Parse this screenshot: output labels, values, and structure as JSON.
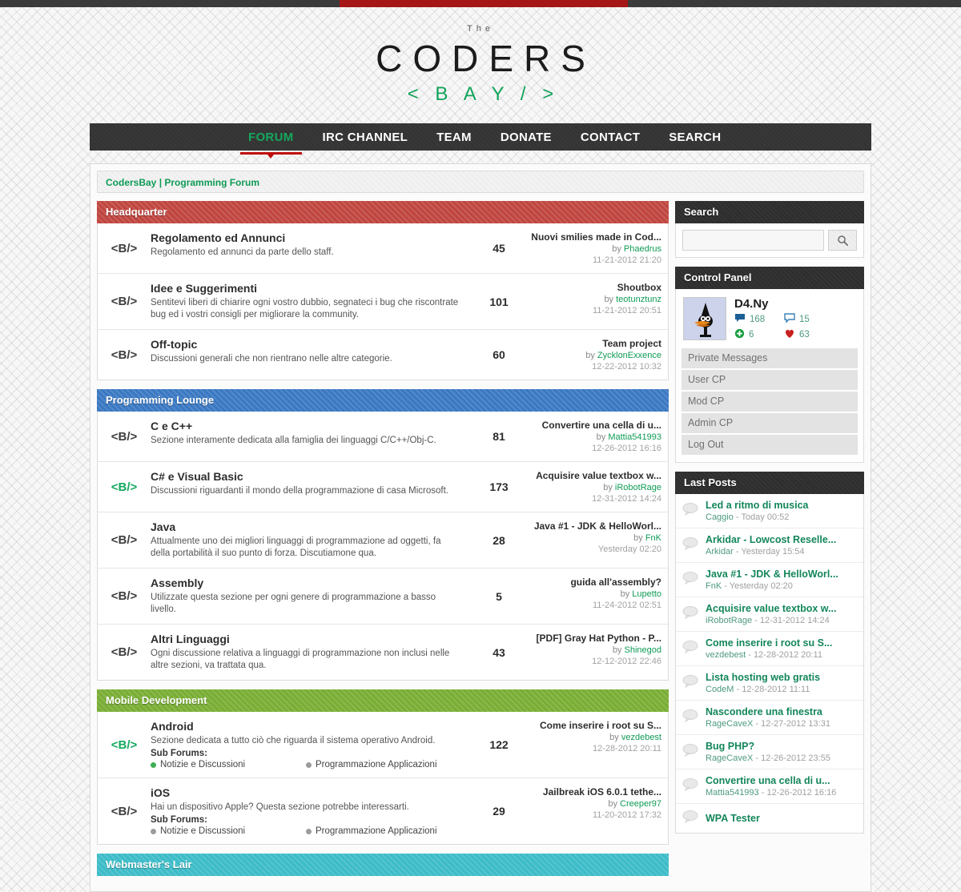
{
  "topbar": {
    "accent_color": "#a51616",
    "bar_color": "#3b3b3b"
  },
  "logo": {
    "pre": "The",
    "main": "CODERS",
    "sub": "< B A Y / >"
  },
  "nav": {
    "items": [
      {
        "label": "FORUM",
        "active": true
      },
      {
        "label": "IRC CHANNEL",
        "active": false
      },
      {
        "label": "TEAM",
        "active": false
      },
      {
        "label": "DONATE",
        "active": false
      },
      {
        "label": "CONTACT",
        "active": false
      },
      {
        "label": "SEARCH",
        "active": false
      }
    ],
    "active_color": "#14a85e",
    "underline_color": "#c00d0d"
  },
  "breadcrumb": {
    "text": "CodersBay | Programming Forum"
  },
  "categories": [
    {
      "title": "Headquarter",
      "color": "#c0453f",
      "forums": [
        {
          "icon": "code-tag-icon",
          "unread": false,
          "title": "Regolamento ed Annunci",
          "desc": "Regolamento ed annunci da parte dello staff.",
          "count": "45",
          "last_title": "Nuovi smilies made in Cod...",
          "last_by_prefix": "by ",
          "last_by": "Phaedrus",
          "last_date": "11-21-2012 21:20",
          "subforums": []
        },
        {
          "icon": "code-tag-icon",
          "unread": false,
          "title": "Idee e Suggerimenti",
          "desc": "Sentitevi liberi di chiarire ogni vostro dubbio, segnateci i bug che riscontrate bug ed i vostri consigli per migliorare la community.",
          "count": "101",
          "last_title": "Shoutbox",
          "last_by_prefix": "by ",
          "last_by": "teotunztunz",
          "last_date": "11-21-2012 20:51",
          "subforums": []
        },
        {
          "icon": "code-tag-icon",
          "unread": false,
          "title": "Off-topic",
          "desc": "Discussioni generali che non rientrano nelle altre categorie.",
          "count": "60",
          "last_title": "Team project",
          "last_by_prefix": "by ",
          "last_by": "ZycklonExxence",
          "last_date": "12-22-2012 10:32",
          "subforums": []
        }
      ]
    },
    {
      "title": "Programming Lounge",
      "color": "#3a78c2",
      "forums": [
        {
          "icon": "code-tag-icon",
          "unread": false,
          "title": "C e C++",
          "desc": "Sezione interamente dedicata alla famiglia dei linguaggi C/C++/Obj-C.",
          "count": "81",
          "last_title": "Convertire una cella di u...",
          "last_by_prefix": "by ",
          "last_by": "Mattia541993",
          "last_date": "12-26-2012 16:16",
          "subforums": []
        },
        {
          "icon": "code-tag-icon",
          "unread": true,
          "title": "C# e Visual Basic",
          "desc": "Discussioni riguardanti il mondo della programmazione di casa Microsoft.",
          "count": "173",
          "last_title": "Acquisire value textbox w...",
          "last_by_prefix": "by ",
          "last_by": "iRobotRage",
          "last_date": "12-31-2012 14:24",
          "subforums": []
        },
        {
          "icon": "code-tag-icon",
          "unread": false,
          "title": "Java",
          "desc": "Attualmente uno dei migliori linguaggi di programmazione ad oggetti, fa della portabilità il suo punto di forza. Discutiamone qua.",
          "count": "28",
          "last_title": "Java #1 - JDK & HelloWorl...",
          "last_by_prefix": "by ",
          "last_by": "FnK",
          "last_date": "Yesterday 02:20",
          "subforums": []
        },
        {
          "icon": "code-tag-icon",
          "unread": false,
          "title": "Assembly",
          "desc": "Utilizzate questa sezione per ogni genere di programmazione a basso livello.",
          "count": "5",
          "last_title": "guida all'assembly?",
          "last_by_prefix": "by ",
          "last_by": "Lupetto",
          "last_date": "11-24-2012 02:51",
          "subforums": []
        },
        {
          "icon": "code-tag-icon",
          "unread": false,
          "title": "Altri Linguaggi",
          "desc": "Ogni discussione relativa a linguaggi di programmazione non inclusi nelle altre sezioni, va trattata qua.",
          "count": "43",
          "last_title": "[PDF] Gray Hat Python - P...",
          "last_by_prefix": "by ",
          "last_by": "Shinegod",
          "last_date": "12-12-2012 22:46",
          "subforums": []
        }
      ]
    },
    {
      "title": "Mobile Development",
      "color": "#79ad34",
      "forums": [
        {
          "icon": "code-tag-icon",
          "unread": true,
          "title": "Android",
          "desc": "Sezione dedicata a tutto ciò che riguarda il sistema operativo Android.",
          "count": "122",
          "last_title": "Come inserire i root su S...",
          "last_by_prefix": "by ",
          "last_by": "vezdebest",
          "last_date": "12-28-2012 20:11",
          "subforums_label": "Sub Forums:",
          "subforums": [
            {
              "label": "Notizie e Discussioni",
              "unread": true
            },
            {
              "label": "Programmazione Applicazioni",
              "unread": false
            }
          ]
        },
        {
          "icon": "code-tag-icon",
          "unread": false,
          "title": "iOS",
          "desc": "Hai un dispositivo Apple? Questa sezione potrebbe interessarti.",
          "count": "29",
          "last_title": "Jailbreak iOS 6.0.1 tethe...",
          "last_by_prefix": "by ",
          "last_by": "Creeper97",
          "last_date": "11-20-2012 17:32",
          "subforums_label": "Sub Forums:",
          "subforums": [
            {
              "label": "Notizie e Discussioni",
              "unread": false
            },
            {
              "label": "Programmazione Applicazioni",
              "unread": false
            }
          ]
        }
      ]
    },
    {
      "title": "Webmaster's Lair",
      "color": "#3cbcc8",
      "forums": []
    }
  ],
  "sidebar": {
    "search": {
      "title": "Search",
      "placeholder": "",
      "value": "",
      "button_icon": "search-icon"
    },
    "control_panel": {
      "title": "Control Panel",
      "user": {
        "name": "D4.Ny",
        "avatar_icon": "daffy-duck-avatar",
        "stats": [
          {
            "icon": "speech-bubble-filled-icon",
            "value": "168"
          },
          {
            "icon": "speech-bubble-outline-icon",
            "value": "15"
          },
          {
            "icon": "plus-circle-icon",
            "value": "6"
          },
          {
            "icon": "heart-icon",
            "value": "63"
          }
        ]
      },
      "links": [
        "Private Messages",
        "User CP",
        "Mod CP",
        "Admin CP",
        "Log Out"
      ]
    },
    "last_posts": {
      "title": "Last Posts",
      "items": [
        {
          "title": "Led a ritmo di musica",
          "author": "Caggio",
          "date": "Today 00:52"
        },
        {
          "title": "Arkidar - Lowcost Reselle...",
          "author": "Arkidar",
          "date": "Yesterday 15:54"
        },
        {
          "title": "Java #1 - JDK & HelloWorl...",
          "author": "FnK",
          "date": "Yesterday 02:20"
        },
        {
          "title": "Acquisire value textbox w...",
          "author": "iRobotRage",
          "date": "12-31-2012 14:24"
        },
        {
          "title": "Come inserire i root su S...",
          "author": "vezdebest",
          "date": "12-28-2012 20:11"
        },
        {
          "title": "Lista hosting web gratis",
          "author": "CodeM",
          "date": "12-28-2012 11:11"
        },
        {
          "title": "Nascondere una finestra",
          "author": "RageCaveX",
          "date": "12-27-2012 13:31"
        },
        {
          "title": "Bug PHP?",
          "author": "RageCaveX",
          "date": "12-26-2012 23:55"
        },
        {
          "title": "Convertire una cella di u...",
          "author": "Mattia541993",
          "date": "12-26-2012 16:16"
        },
        {
          "title": "WPA Tester",
          "author": "",
          "date": ""
        }
      ]
    }
  }
}
